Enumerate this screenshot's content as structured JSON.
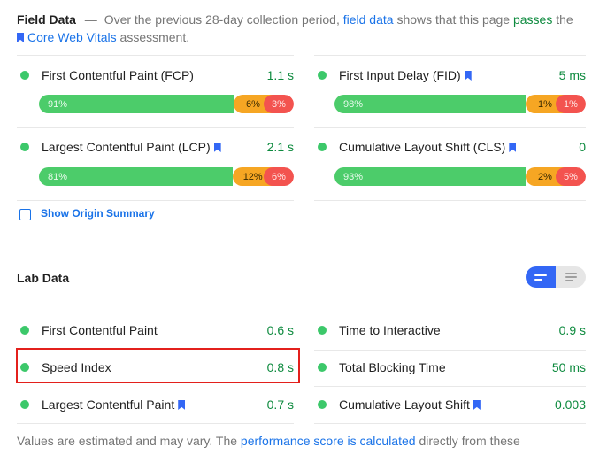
{
  "field_data": {
    "title": "Field Data",
    "dash": "—",
    "desc_1": "Over the previous 28-day collection period,",
    "link_field_data": "field data",
    "desc_2": "shows that this page",
    "passes": "passes",
    "desc_3": "the",
    "link_cwv": "Core Web Vitals",
    "desc_4": "assessment.",
    "metrics": [
      {
        "name": "First Contentful Paint (FCP)",
        "value": "1.1 s",
        "bookmark": false,
        "dist": {
          "good": 91,
          "average": 6,
          "poor": 3
        },
        "labels": [
          "91%",
          "6%",
          "3%"
        ]
      },
      {
        "name": "First Input Delay (FID)",
        "value": "5 ms",
        "bookmark": true,
        "dist": {
          "good": 98,
          "average": 1,
          "poor": 1
        },
        "labels": [
          "98%",
          "1%",
          "1%"
        ]
      },
      {
        "name": "Largest Contentful Paint (LCP)",
        "value": "2.1 s",
        "bookmark": true,
        "dist": {
          "good": 81,
          "average": 12,
          "poor": 6
        },
        "labels": [
          "81%",
          "12%",
          "6%"
        ]
      },
      {
        "name": "Cumulative Layout Shift (CLS)",
        "value": "0",
        "bookmark": true,
        "dist": {
          "good": 93,
          "average": 2,
          "poor": 5
        },
        "labels": [
          "93%",
          "2%",
          "5%"
        ]
      }
    ],
    "show_origin_summary": "Show Origin Summary",
    "show_origin_checked": false
  },
  "lab_data": {
    "title": "Lab Data",
    "view_toggle": {
      "active": "compact-view",
      "options": [
        "compact-view",
        "expanded-view"
      ]
    },
    "metrics": [
      {
        "name": "First Contentful Paint",
        "value": "0.6 s",
        "bookmark": false
      },
      {
        "name": "Time to Interactive",
        "value": "0.9 s",
        "bookmark": false
      },
      {
        "name": "Speed Index",
        "value": "0.8 s",
        "bookmark": false,
        "highlighted": true
      },
      {
        "name": "Total Blocking Time",
        "value": "50 ms",
        "bookmark": false
      },
      {
        "name": "Largest Contentful Paint",
        "value": "0.7 s",
        "bookmark": true
      },
      {
        "name": "Cumulative Layout Shift",
        "value": "0.003",
        "bookmark": true
      }
    ]
  },
  "footer": {
    "text_1": "Values are estimated and may vary. The",
    "link": "performance score is calculated",
    "text_2": "directly from these"
  },
  "colors": {
    "good": "#4ccc6a",
    "average": "#f6a623",
    "poor": "#f3534f",
    "link": "#1a73e8",
    "pass_value": "#0d8a3e",
    "highlight_border": "#e3201c"
  }
}
